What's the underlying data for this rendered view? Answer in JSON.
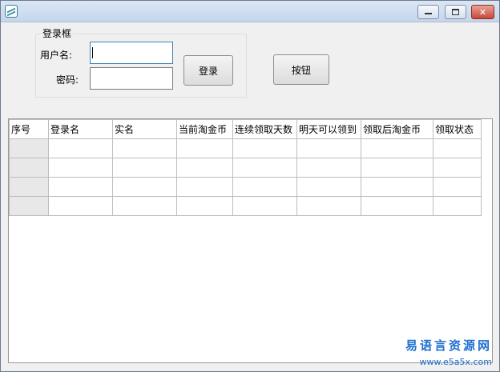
{
  "window": {
    "title": "",
    "controls": {
      "minimize": "—",
      "maximize": "□",
      "close": "✕"
    }
  },
  "login_group": {
    "title": "登录框",
    "username_label": "用户名:",
    "password_label": "密码:",
    "username_value": "",
    "password_value": ""
  },
  "buttons": {
    "login": "登录",
    "action": "按钮"
  },
  "grid": {
    "columns": [
      "序号",
      "登录名",
      "实名",
      "当前淘金币",
      "连续领取天数",
      "明天可以领到",
      "领取后淘金币",
      "领取状态"
    ],
    "rows": [
      [
        "",
        "",
        "",
        "",
        "",
        "",
        "",
        ""
      ],
      [
        "",
        "",
        "",
        "",
        "",
        "",
        "",
        ""
      ],
      [
        "",
        "",
        "",
        "",
        "",
        "",
        "",
        ""
      ],
      [
        "",
        "",
        "",
        "",
        "",
        "",
        "",
        ""
      ]
    ]
  },
  "watermark": {
    "title": "易语言资源网",
    "url": "www.e5a5x.com"
  }
}
